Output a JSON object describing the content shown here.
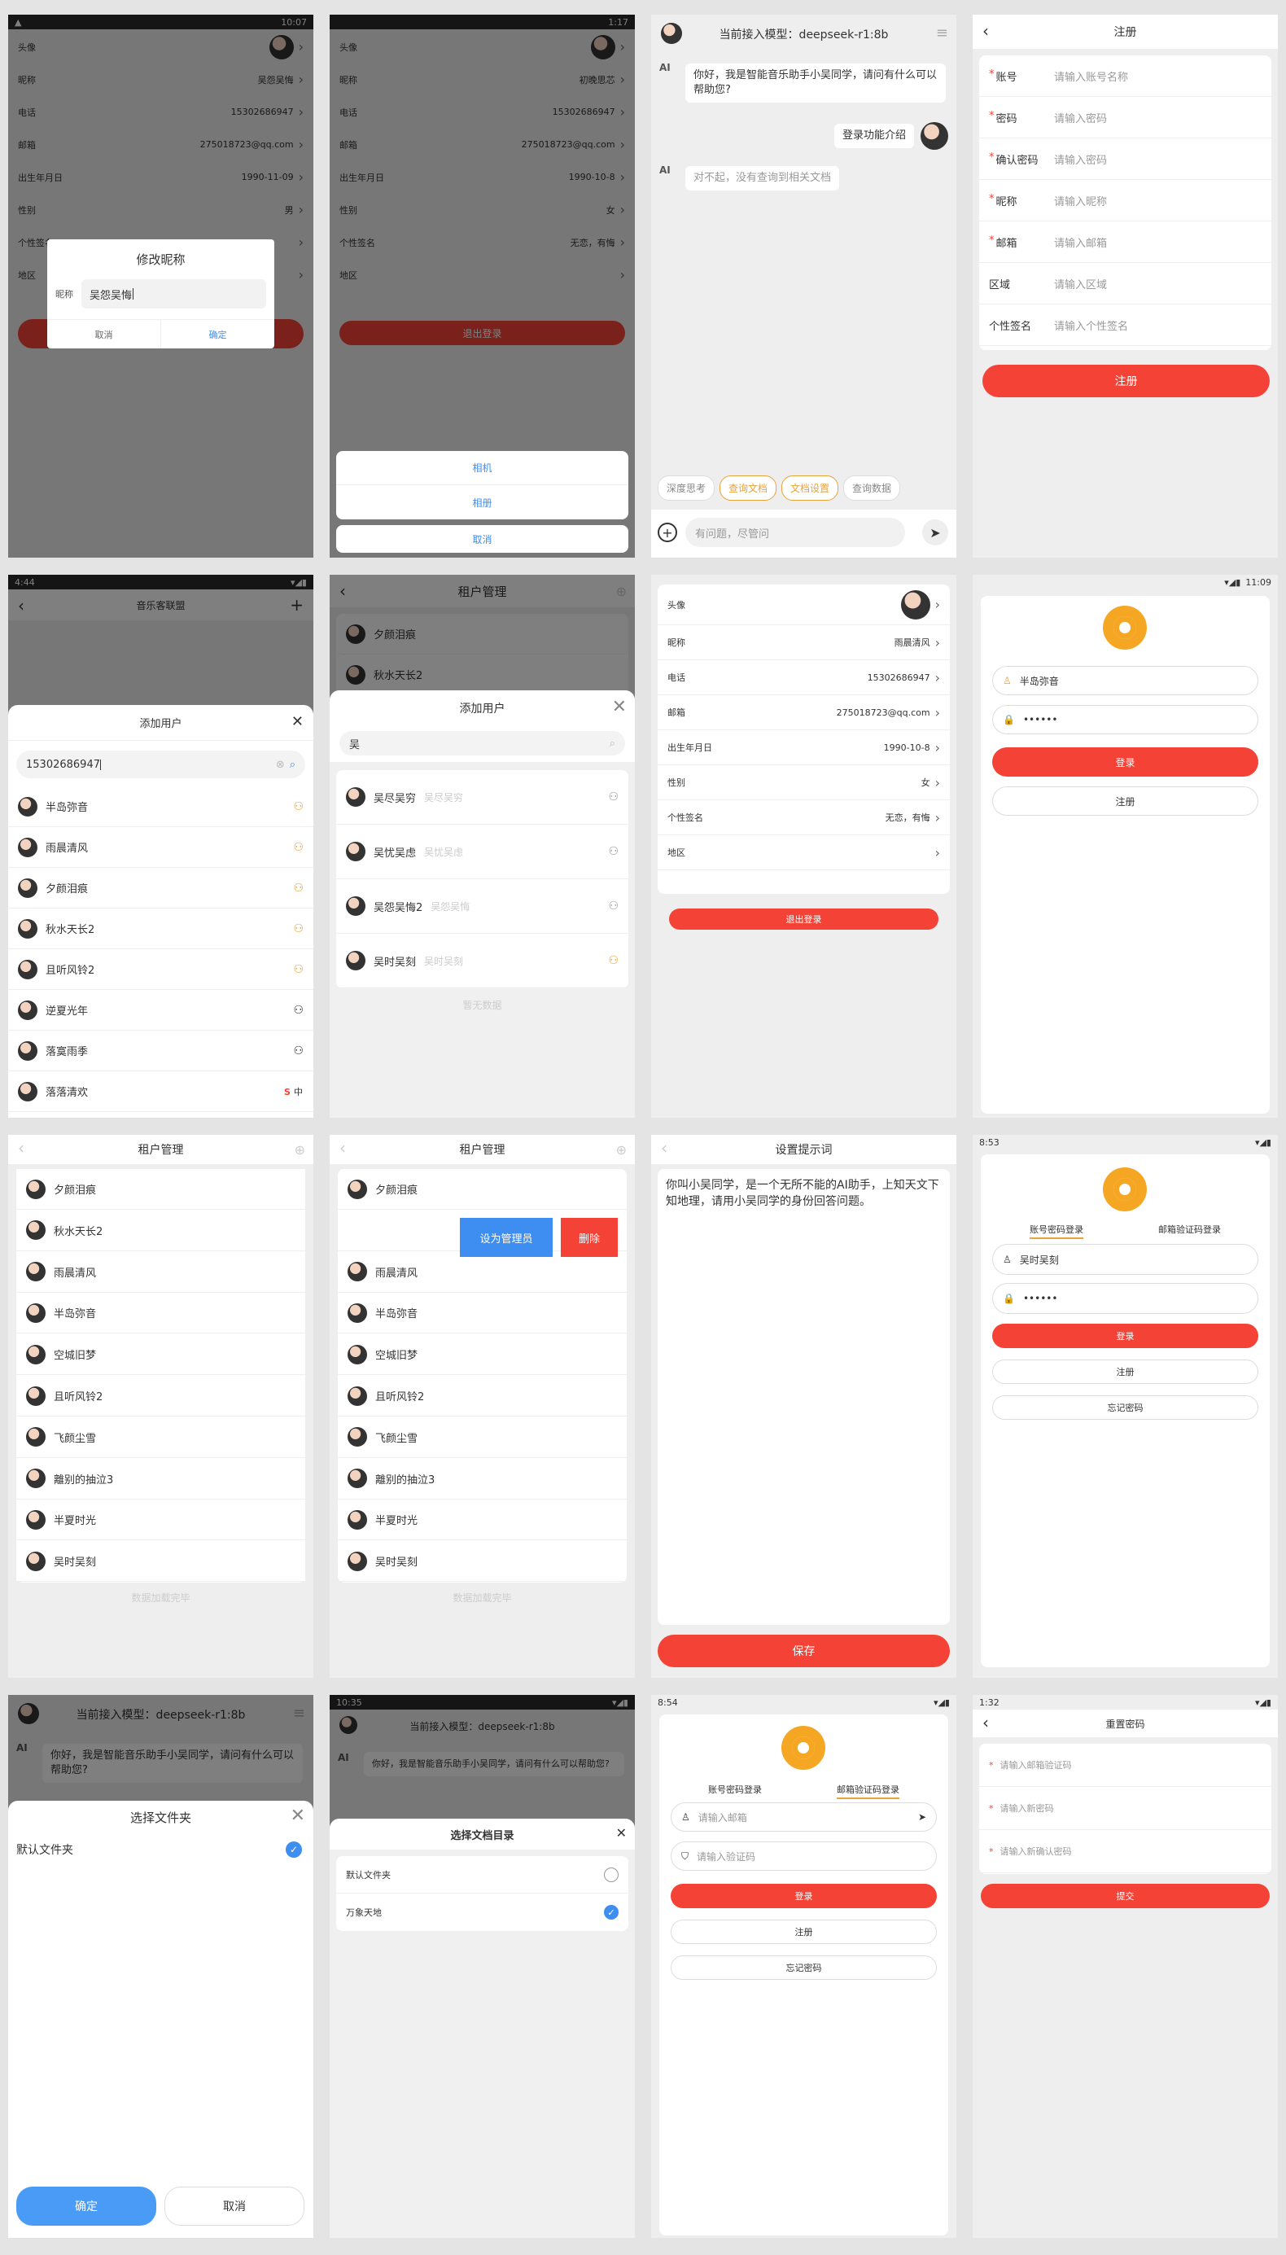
{
  "p1": {
    "status_time": "10:07",
    "rows": [
      [
        "头像",
        ""
      ],
      [
        "昵称",
        "吴怨吴悔"
      ],
      [
        "电话",
        "15302686947"
      ],
      [
        "邮箱",
        "275018723@qq.com"
      ],
      [
        "出生年月日",
        "1990-11-09"
      ],
      [
        "性别",
        "男"
      ],
      [
        "个性签名",
        ""
      ],
      [
        "地区",
        ""
      ]
    ],
    "dialog": {
      "title": "修改昵称",
      "label": "昵称",
      "value": "吴怨吴悔",
      "cancel": "取消",
      "ok": "确定"
    }
  },
  "p2": {
    "status_time": "1:17",
    "rows": [
      [
        "头像",
        ""
      ],
      [
        "昵称",
        "初晚思芯"
      ],
      [
        "电话",
        "15302686947"
      ],
      [
        "邮箱",
        "275018723@qq.com"
      ],
      [
        "出生年月日",
        "1990-10-8"
      ],
      [
        "性别",
        "女"
      ],
      [
        "个性签名",
        "无恋，有悔"
      ],
      [
        "地区",
        ""
      ]
    ],
    "logout": "退出登录",
    "sheet": [
      "相机",
      "相册"
    ],
    "cancel": "取消"
  },
  "p3": {
    "title": "当前接入模型：deepseek-r1:8b",
    "bubble1": "你好，我是智能音乐助手小吴同学，请问有什么可以帮助您?",
    "user_msg": "登录功能介绍",
    "bubble2": "对不起，没有查询到相关文档",
    "ai": "AI",
    "chips": [
      "深度思考",
      "查询文档",
      "文档设置",
      "查询数据"
    ],
    "placeholder": "有问题，尽管问"
  },
  "p4": {
    "title": "注册",
    "fields": [
      [
        "账号",
        "请输入账号名称",
        true
      ],
      [
        "密码",
        "请输入密码",
        true
      ],
      [
        "确认密码",
        "请输入密码",
        true
      ],
      [
        "昵称",
        "请输入昵称",
        true
      ],
      [
        "邮箱",
        "请输入邮箱",
        true
      ],
      [
        "区域",
        "请输入区域",
        false
      ],
      [
        "个性签名",
        "请输入个性签名",
        false
      ]
    ],
    "btn": "注册"
  },
  "p5": {
    "status_time": "4:44",
    "bg_title": "音乐客联盟",
    "sheet_title": "添加用户",
    "search": "15302686947",
    "users": [
      "半岛弥音",
      "雨晨清风",
      "夕颜泪痕",
      "秋水天长2",
      "且听风铃2",
      "逆夏光年",
      "落寞雨季",
      "落落清欢"
    ],
    "ime1": "S",
    "ime2": "中"
  },
  "p6": {
    "bg_title": "租户管理",
    "bg_users": [
      "夕颜泪痕",
      "秋水天长2"
    ],
    "sheet_title": "添加用户",
    "search": "吴",
    "users": [
      [
        "吴尽吴穷",
        "吴尽吴穷"
      ],
      [
        "吴忧吴虑",
        "吴忧吴虑"
      ],
      [
        "吴怨吴悔2",
        "吴怨吴悔"
      ],
      [
        "吴时吴刻",
        "吴时吴刻"
      ]
    ],
    "empty": "暂无数据"
  },
  "p7": {
    "rows": [
      [
        "头像",
        ""
      ],
      [
        "昵称",
        "雨晨清风"
      ],
      [
        "电话",
        "15302686947"
      ],
      [
        "邮箱",
        "275018723@qq.com"
      ],
      [
        "出生年月日",
        "1990-10-8"
      ],
      [
        "性别",
        "女"
      ],
      [
        "个性签名",
        "无恋，有悔"
      ],
      [
        "地区",
        ""
      ]
    ],
    "logout": "退出登录"
  },
  "p8": {
    "status_time": "11:09",
    "user": "半岛弥音",
    "pwd": "••••••",
    "login": "登录",
    "register": "注册"
  },
  "p9": {
    "title": "租户管理",
    "users": [
      "夕颜泪痕",
      "秋水天长2",
      "雨晨清风",
      "半岛弥音",
      "空城旧梦",
      "且听风铃2",
      "飞颜尘雪",
      "離别的抽泣3",
      "半夏时光",
      "吴时吴刻"
    ],
    "footer": "数据加载完毕"
  },
  "p10": {
    "title": "租户管理",
    "users": [
      "夕颜泪痕",
      "",
      "雨晨清风",
      "半岛弥音",
      "空城旧梦",
      "且听风铃2",
      "飞颜尘雪",
      "離别的抽泣3",
      "半夏时光",
      "吴时吴刻"
    ],
    "admin": "设为管理员",
    "del": "删除",
    "footer": "数据加载完毕"
  },
  "p11": {
    "title": "设置提示词",
    "text": "你叫小吴同学，是一个无所不能的AI助手，上知天文下知地理，请用小吴同学的身份回答问题。",
    "save": "保存"
  },
  "p12": {
    "status_time": "8:53",
    "tab1": "账号密码登录",
    "tab2": "邮箱验证码登录",
    "user": "吴时吴刻",
    "pwd": "••••••",
    "login": "登录",
    "register": "注册",
    "forgot": "忘记密码"
  },
  "p13": {
    "title": "当前接入模型：deepseek-r1:8b",
    "bubble": "你好，我是智能音乐助手小吴同学，请问有什么可以帮助您?",
    "ai": "AI",
    "sheet_title": "选择文件夹",
    "item": "默认文件夹",
    "ok": "确定",
    "cancel": "取消"
  },
  "p14": {
    "status_time": "10:35",
    "title": "当前接入模型：deepseek-r1:8b",
    "bubble": "你好，我是智能音乐助手小吴同学，请问有什么可以帮助您?",
    "ai": "AI",
    "sheet_title": "选择文档目录",
    "items": [
      "默认文件夹",
      "万象天地"
    ]
  },
  "p15": {
    "status_time": "8:54",
    "tab1": "账号密码登录",
    "tab2": "邮箱验证码登录",
    "email_ph": "请输入邮箱",
    "code_ph": "请输入验证码",
    "login": "登录",
    "register": "注册",
    "forgot": "忘记密码"
  },
  "p16": {
    "status_time": "1:32",
    "title": "重置密码",
    "fields": [
      "请输入邮箱验证码",
      "请输入新密码",
      "请输入新确认密码"
    ],
    "submit": "提交"
  },
  "colors": {
    "red": "#f44336",
    "orange": "#e8a33b",
    "blue": "#3d8ef0"
  }
}
